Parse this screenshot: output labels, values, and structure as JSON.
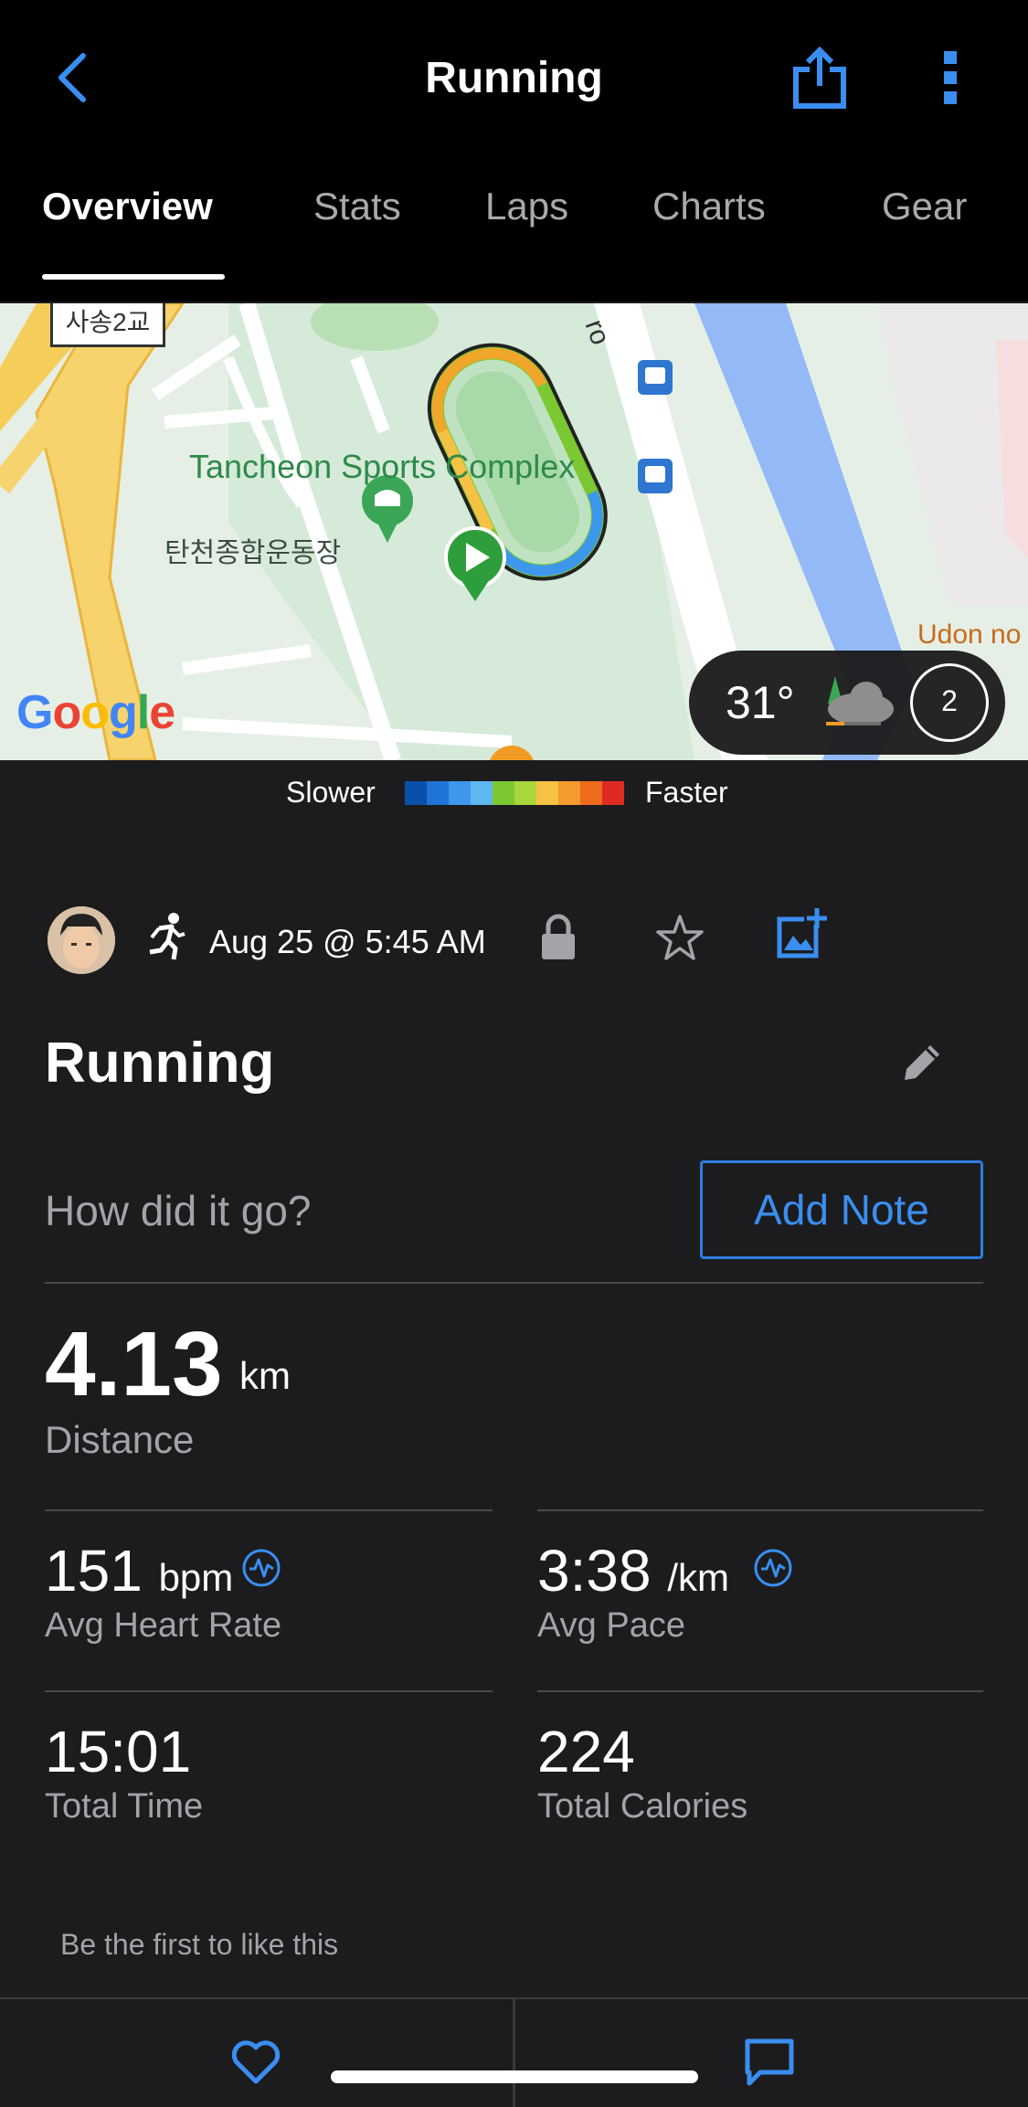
{
  "header": {
    "title": "Running",
    "tabs": [
      {
        "label": "Overview",
        "active": true
      },
      {
        "label": "Stats",
        "active": false
      },
      {
        "label": "Laps",
        "active": false
      },
      {
        "label": "Charts",
        "active": false
      },
      {
        "label": "Gear",
        "active": false
      }
    ],
    "icons": {
      "back": "chevron-left-icon",
      "share": "share-icon",
      "more": "more-vertical-icon"
    }
  },
  "map": {
    "place_name": "Tancheon Sports Complex",
    "place_name_kr": "탄천종합운동장",
    "road_sign": "사송2교",
    "poi_partial": "Udon no",
    "road_partial": "ro",
    "attribution": "Google",
    "weather": {
      "temperature": "31°",
      "wind": "2",
      "icon": "cloudy-icon"
    }
  },
  "legend": {
    "slower": "Slower",
    "faster": "Faster",
    "colors": [
      "#0a4fa8",
      "#1f74d6",
      "#3d98ec",
      "#5fb7f2",
      "#7bc832",
      "#a9d63d",
      "#f6c244",
      "#f59a2d",
      "#ee6a1c",
      "#df2a22"
    ]
  },
  "activity": {
    "date": "Aug 25 @ 5:45 AM",
    "title": "Running",
    "prompt": "How did it go?",
    "add_note": "Add Note"
  },
  "stats": {
    "distance": {
      "value": "4.13",
      "unit": "km",
      "label": "Distance"
    },
    "avg_hr": {
      "value": "151",
      "unit": "bpm",
      "label": "Avg Heart Rate"
    },
    "avg_pace": {
      "value": "3:38",
      "unit": "/km",
      "label": "Avg Pace"
    },
    "total_time": {
      "value": "15:01",
      "label": "Total Time"
    },
    "calories": {
      "value": "224",
      "label": "Total Calories"
    }
  },
  "social": {
    "likes_text": "Be the first to like this"
  },
  "colors": {
    "accent": "#3a8ef0",
    "background": "#1c1c1e",
    "header": "#000000"
  }
}
